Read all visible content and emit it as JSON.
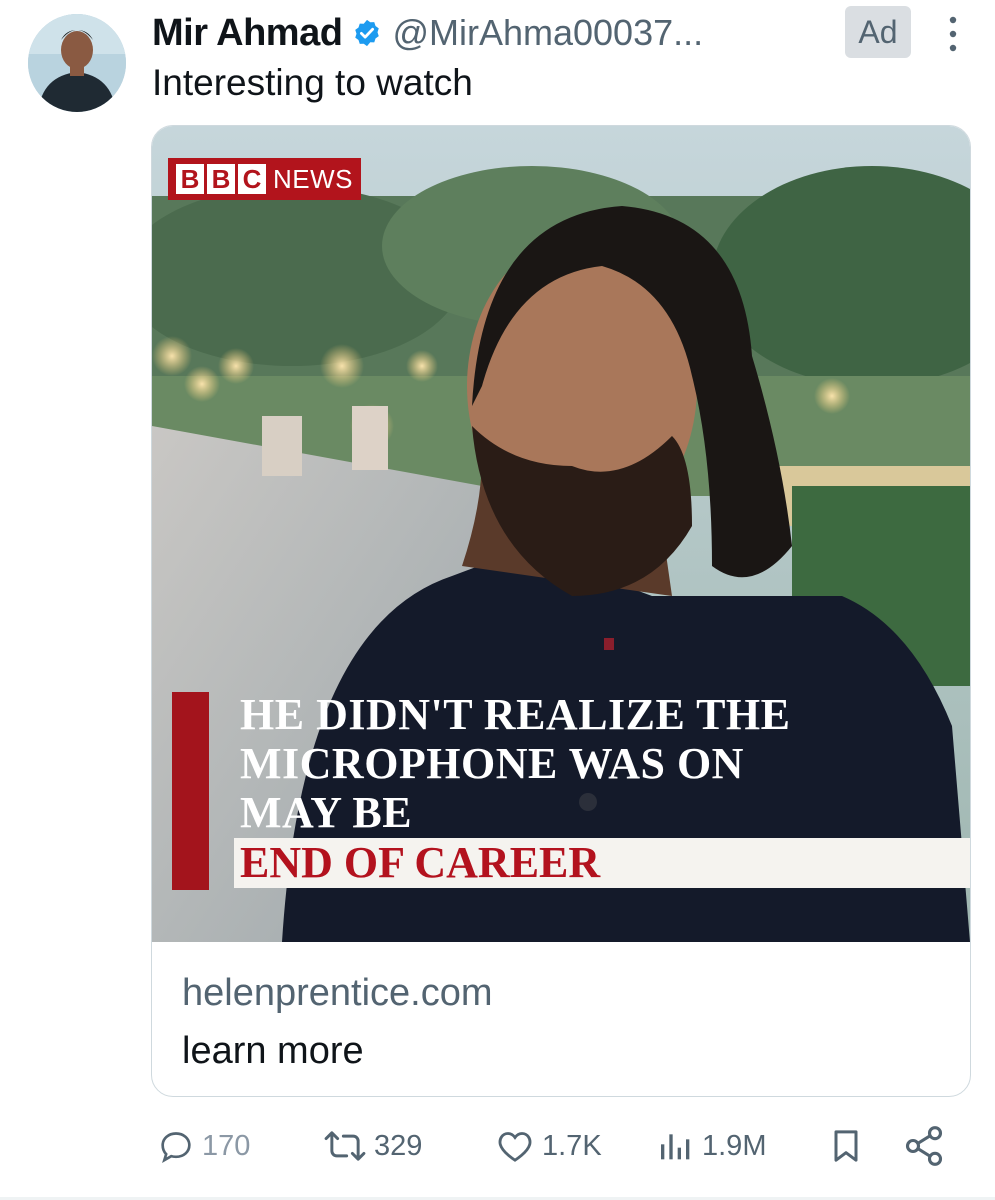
{
  "post": {
    "author_name": "Mir Ahmad",
    "handle": "@MirAhma00037...",
    "ad_label": "Ad",
    "text": "Interesting to watch"
  },
  "card": {
    "logo_letters": [
      "B",
      "B",
      "C"
    ],
    "logo_word": "NEWS",
    "headline_lines": [
      "HE DIDN'T REALIZE THE",
      "MICROPHONE WAS ON",
      "MAY BE"
    ],
    "headline_tag": "END OF CAREER",
    "domain": "helenprentice.com",
    "cta": "learn more"
  },
  "actions": {
    "replies": "170",
    "reposts": "329",
    "likes": "1.7K",
    "views": "1.9M"
  },
  "colors": {
    "verified": "#1d9bf0",
    "bbc_red": "#b2141c",
    "muted_text": "#536471"
  },
  "icons": [
    "verified-badge-icon",
    "more-icon",
    "reply-icon",
    "repost-icon",
    "like-icon",
    "views-icon",
    "bookmark-icon",
    "share-icon"
  ]
}
